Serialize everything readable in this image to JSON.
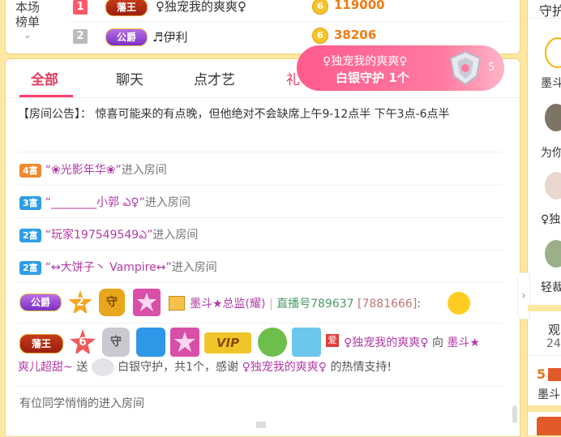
{
  "ranking": {
    "label_line1": "本场",
    "label_line2": "榜单",
    "rows": [
      {
        "rank": "1",
        "badge": "藩王",
        "name": "♀独宠我的爽爽♀",
        "coin": "6",
        "score": "119000"
      },
      {
        "rank": "2",
        "badge": "公爵",
        "name": "♬伊利",
        "coin": "6",
        "score": "38206"
      }
    ]
  },
  "tabs": [
    "全部",
    "聊天",
    "点才艺",
    "礼"
  ],
  "guard_popup": {
    "name": "♀独宠我的爽爽♀",
    "text": "白银守护",
    "count": "1个",
    "badge": "5"
  },
  "announcement": "【房间公告】： 惊喜可能来的有点晚，但他绝对不会缺席上午9-12点半 下午3点-6点半",
  "entries": [
    {
      "level": "4富",
      "name": "“❀光影年华❀”",
      "action": "进入房间"
    },
    {
      "level": "3富",
      "name": "“________小郭 ఎ♀”",
      "action": "进入房间"
    },
    {
      "level": "2富",
      "name": "“玩家197549549ఎ”",
      "action": "进入房间"
    },
    {
      "level": "2富",
      "name": "“↔大饼子丶 Vampire↔”",
      "action": "进入房间"
    }
  ],
  "msg_line": {
    "badge": "公爵",
    "level_num": "2",
    "guard_char": "守",
    "user": "墨斗★总监(耀)",
    "separator": "|",
    "room_label": "直播号789637",
    "room_id": "[7881666]",
    "colon": ":"
  },
  "gift_line": {
    "badge": "藩王",
    "level_num": "6",
    "guard_char": "守",
    "vip": "VIP",
    "tag": "爱",
    "giver": "♀独宠我的爽爽♀",
    "to": "向",
    "receiver_a": "墨斗★",
    "receiver_b": "爽儿超甜~",
    "send": "送",
    "gift": "白银守护，共1个，感谢",
    "thanks_name": "♀独宠我的爽爽♀",
    "tail": "的热情支持!"
  },
  "last_line": "有位同学悄悄的进入房间",
  "sidebar": {
    "title": "守护",
    "names": [
      "墨斗",
      "为你",
      "♀独",
      "轻裁"
    ],
    "watch_label": "观",
    "watch_count": "24",
    "rank_num": "5",
    "rank_name": "墨斗"
  },
  "colors": {
    "accent": "#ff3d6e",
    "gold": "#f27b10",
    "frame": "#fde7a1"
  }
}
